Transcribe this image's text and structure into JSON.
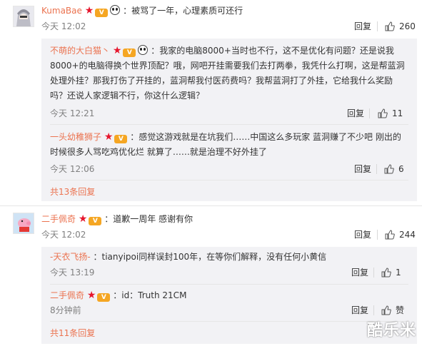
{
  "comments": [
    {
      "name": "KumaBae",
      "text": "：被骂了一年，心理素质可还行",
      "time": "今天 12:02",
      "reply_label": "回复",
      "likes": "260",
      "replies": [
        {
          "name": "不萌的大白猫丶",
          "lines": [
            "：我家的电脑8000+当时也不行，这不是优化有问题？还是说我",
            "8000+的电脑得换个世界顶配？哦，网吧开挂需要我们去打两拳，我凭什么打啊，这是帮蓝洞",
            "处理外挂？那我打伤了开挂的，蓝洞帮我付医药费吗？我帮蓝洞打了外挂，它给我什么奖励",
            "吗？还说人家逻辑不行，你这什么逻辑？"
          ],
          "time": "今天 12:21",
          "reply_label": "回复",
          "likes": "11"
        },
        {
          "name": "一头幼稚狮子",
          "lines": [
            "：感觉这游戏就是在坑我们……中国这么多玩家  蓝洞赚了不少吧  刚出的",
            "时候很多人骂吃鸡优化烂  就算了……就是治理不好外挂了"
          ],
          "time": "今天 12:06",
          "reply_label": "回复",
          "likes": "6"
        }
      ],
      "more_replies": "共13条回复"
    },
    {
      "name": "二手佩奇",
      "text": "：道歉一周年 感谢有你",
      "time": "今天 12:02",
      "reply_label": "回复",
      "likes": "244",
      "replies": [
        {
          "name": "-天衣飞扬-",
          "lines": [
            "：tianyipoi同样误封100年，在等你们解释，没有任何小黄信"
          ],
          "time": "今天 13:19",
          "reply_label": "回复",
          "likes": "1"
        },
        {
          "name": "二手佩奇",
          "lines": [
            "：id：Truth 21CM"
          ],
          "time": "8分钟前",
          "reply_label": "回复",
          "likes": "赞"
        }
      ],
      "more_replies": "共11条回复"
    }
  ],
  "watermark": "酷乐米",
  "colors": {
    "name": "#eb7350",
    "badge_star": "#e6162d",
    "sub_bg": "#f2f2f5",
    "time": "#808080"
  }
}
